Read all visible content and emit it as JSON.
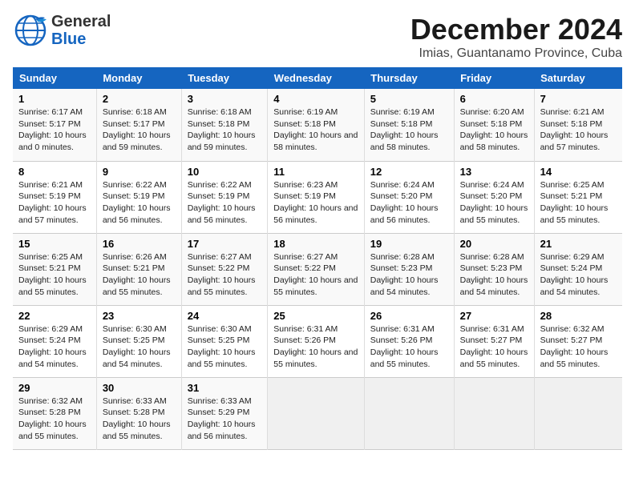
{
  "logo": {
    "general": "General",
    "blue": "Blue"
  },
  "title": "December 2024",
  "subtitle": "Imias, Guantanamo Province, Cuba",
  "days_of_week": [
    "Sunday",
    "Monday",
    "Tuesday",
    "Wednesday",
    "Thursday",
    "Friday",
    "Saturday"
  ],
  "weeks": [
    [
      {
        "day": 1,
        "sunrise": "6:17 AM",
        "sunset": "5:17 PM",
        "daylight": "10 hours and 0 minutes."
      },
      {
        "day": 2,
        "sunrise": "6:18 AM",
        "sunset": "5:17 PM",
        "daylight": "10 hours and 59 minutes."
      },
      {
        "day": 3,
        "sunrise": "6:18 AM",
        "sunset": "5:18 PM",
        "daylight": "10 hours and 59 minutes."
      },
      {
        "day": 4,
        "sunrise": "6:19 AM",
        "sunset": "5:18 PM",
        "daylight": "10 hours and 58 minutes."
      },
      {
        "day": 5,
        "sunrise": "6:19 AM",
        "sunset": "5:18 PM",
        "daylight": "10 hours and 58 minutes."
      },
      {
        "day": 6,
        "sunrise": "6:20 AM",
        "sunset": "5:18 PM",
        "daylight": "10 hours and 58 minutes."
      },
      {
        "day": 7,
        "sunrise": "6:21 AM",
        "sunset": "5:18 PM",
        "daylight": "10 hours and 57 minutes."
      }
    ],
    [
      {
        "day": 8,
        "sunrise": "6:21 AM",
        "sunset": "5:19 PM",
        "daylight": "10 hours and 57 minutes."
      },
      {
        "day": 9,
        "sunrise": "6:22 AM",
        "sunset": "5:19 PM",
        "daylight": "10 hours and 56 minutes."
      },
      {
        "day": 10,
        "sunrise": "6:22 AM",
        "sunset": "5:19 PM",
        "daylight": "10 hours and 56 minutes."
      },
      {
        "day": 11,
        "sunrise": "6:23 AM",
        "sunset": "5:19 PM",
        "daylight": "10 hours and 56 minutes."
      },
      {
        "day": 12,
        "sunrise": "6:24 AM",
        "sunset": "5:20 PM",
        "daylight": "10 hours and 56 minutes."
      },
      {
        "day": 13,
        "sunrise": "6:24 AM",
        "sunset": "5:20 PM",
        "daylight": "10 hours and 55 minutes."
      },
      {
        "day": 14,
        "sunrise": "6:25 AM",
        "sunset": "5:21 PM",
        "daylight": "10 hours and 55 minutes."
      }
    ],
    [
      {
        "day": 15,
        "sunrise": "6:25 AM",
        "sunset": "5:21 PM",
        "daylight": "10 hours and 55 minutes."
      },
      {
        "day": 16,
        "sunrise": "6:26 AM",
        "sunset": "5:21 PM",
        "daylight": "10 hours and 55 minutes."
      },
      {
        "day": 17,
        "sunrise": "6:27 AM",
        "sunset": "5:22 PM",
        "daylight": "10 hours and 55 minutes."
      },
      {
        "day": 18,
        "sunrise": "6:27 AM",
        "sunset": "5:22 PM",
        "daylight": "10 hours and 55 minutes."
      },
      {
        "day": 19,
        "sunrise": "6:28 AM",
        "sunset": "5:23 PM",
        "daylight": "10 hours and 54 minutes."
      },
      {
        "day": 20,
        "sunrise": "6:28 AM",
        "sunset": "5:23 PM",
        "daylight": "10 hours and 54 minutes."
      },
      {
        "day": 21,
        "sunrise": "6:29 AM",
        "sunset": "5:24 PM",
        "daylight": "10 hours and 54 minutes."
      }
    ],
    [
      {
        "day": 22,
        "sunrise": "6:29 AM",
        "sunset": "5:24 PM",
        "daylight": "10 hours and 54 minutes."
      },
      {
        "day": 23,
        "sunrise": "6:30 AM",
        "sunset": "5:25 PM",
        "daylight": "10 hours and 54 minutes."
      },
      {
        "day": 24,
        "sunrise": "6:30 AM",
        "sunset": "5:25 PM",
        "daylight": "10 hours and 55 minutes."
      },
      {
        "day": 25,
        "sunrise": "6:31 AM",
        "sunset": "5:26 PM",
        "daylight": "10 hours and 55 minutes."
      },
      {
        "day": 26,
        "sunrise": "6:31 AM",
        "sunset": "5:26 PM",
        "daylight": "10 hours and 55 minutes."
      },
      {
        "day": 27,
        "sunrise": "6:31 AM",
        "sunset": "5:27 PM",
        "daylight": "10 hours and 55 minutes."
      },
      {
        "day": 28,
        "sunrise": "6:32 AM",
        "sunset": "5:27 PM",
        "daylight": "10 hours and 55 minutes."
      }
    ],
    [
      {
        "day": 29,
        "sunrise": "6:32 AM",
        "sunset": "5:28 PM",
        "daylight": "10 hours and 55 minutes."
      },
      {
        "day": 30,
        "sunrise": "6:33 AM",
        "sunset": "5:28 PM",
        "daylight": "10 hours and 55 minutes."
      },
      {
        "day": 31,
        "sunrise": "6:33 AM",
        "sunset": "5:29 PM",
        "daylight": "10 hours and 56 minutes."
      },
      null,
      null,
      null,
      null
    ]
  ]
}
